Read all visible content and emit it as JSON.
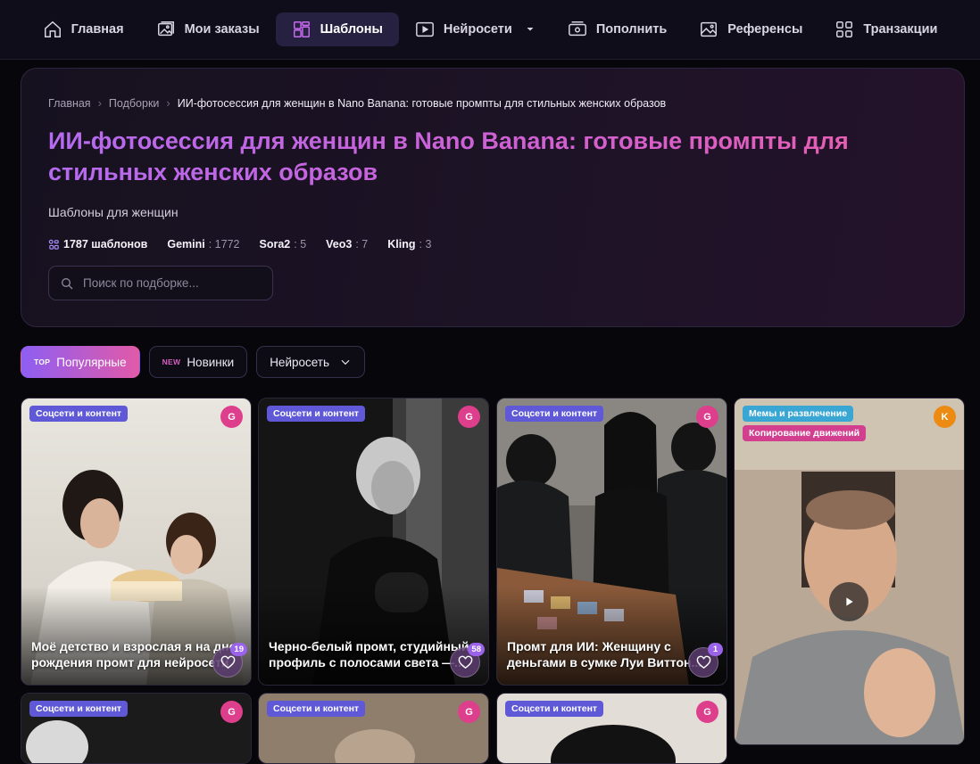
{
  "nav": {
    "items": [
      {
        "label": "Главная",
        "icon": "home-icon",
        "active": false
      },
      {
        "label": "Мои заказы",
        "icon": "gallery-icon",
        "active": false
      },
      {
        "label": "Шаблоны",
        "icon": "templates-icon",
        "active": true
      },
      {
        "label": "Нейросети",
        "icon": "video-icon",
        "active": false,
        "dropdown": true
      },
      {
        "label": "Пополнить",
        "icon": "wallet-icon",
        "active": false
      },
      {
        "label": "Референсы",
        "icon": "image-icon",
        "active": false
      },
      {
        "label": "Транзакции",
        "icon": "grid-icon",
        "active": false
      }
    ]
  },
  "breadcrumb": [
    "Главная",
    "Подборки",
    "ИИ-фотосессия для женщин в Nano Banana: готовые промпты для стильных женских образов"
  ],
  "hero": {
    "title": "ИИ-фотосессия для женщин в Nano Banana: готовые промпты для стильных женских образов",
    "subtitle": "Шаблоны для женщин",
    "stats": {
      "total_label": "1787 шаблонов",
      "models": [
        {
          "name": "Gemini",
          "count": "1772"
        },
        {
          "name": "Sora2",
          "count": "5"
        },
        {
          "name": "Veo3",
          "count": "7"
        },
        {
          "name": "Kling",
          "count": "3"
        }
      ]
    },
    "search": {
      "placeholder": "Поиск по подборке...",
      "value": ""
    }
  },
  "filters": {
    "popular": {
      "tag": "TOP",
      "label": "Популярные"
    },
    "new": {
      "tag": "NEW",
      "label": "Новинки"
    },
    "network": {
      "label": "Нейросеть"
    }
  },
  "cards": [
    {
      "badges": [
        "Соцсети и контент"
      ],
      "model": "G",
      "title_line1": "Моё детство и взрослая я на дне",
      "title_line2": "рождения промт для нейросети",
      "likes": "19"
    },
    {
      "badges": [
        "Соцсети и контент"
      ],
      "model": "G",
      "title_line1": "Черно-белый промт, студийный",
      "title_line2": "профиль с полосами света —...",
      "likes": "58"
    },
    {
      "badges": [
        "Соцсети и контент"
      ],
      "model": "G",
      "title_line1": "Промт для ИИ: Женщину с",
      "title_line2": "деньгами в сумке Луи Виттон...",
      "likes": "1"
    },
    {
      "badges": [
        "Мемы и развлечение",
        "Копирование движений"
      ],
      "model": "K"
    },
    {
      "badges": [
        "Соцсети и контент"
      ],
      "model": "G"
    },
    {
      "badges": [
        "Соцсети и контент"
      ],
      "model": "G"
    },
    {
      "badges": [
        "Соцсети и контент"
      ],
      "model": "G"
    }
  ],
  "colors": {
    "accent_purple": "#8e5ef2",
    "accent_pink": "#e15aa8",
    "badge_blue": "#5f59d8",
    "badge_cyan": "#3aa6d4",
    "badge_pink": "#d33f8f",
    "model_pink": "#de3f8d",
    "model_orange": "#ed8a12"
  }
}
